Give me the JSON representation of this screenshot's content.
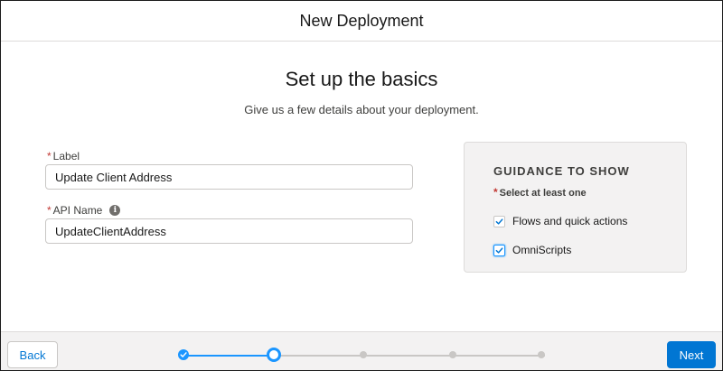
{
  "header": {
    "title": "New Deployment"
  },
  "main": {
    "heading": "Set up the basics",
    "subheading": "Give us a few details about your deployment."
  },
  "form": {
    "label_field": {
      "required_marker": "*",
      "label": "Label",
      "value": "Update Client Address"
    },
    "api_field": {
      "required_marker": "*",
      "label": "API Name",
      "value": "UpdateClientAddress",
      "info_icon": "info-icon"
    }
  },
  "guidance": {
    "title": "GUIDANCE TO SHOW",
    "required_marker": "*",
    "requirement": "Select at least one",
    "options": [
      {
        "label": "Flows and quick actions",
        "checked": true
      },
      {
        "label": "OmniScripts",
        "checked": true
      }
    ]
  },
  "footer": {
    "back_label": "Back",
    "next_label": "Next",
    "progress": {
      "steps": 5,
      "completed": 1,
      "current": 2
    }
  },
  "colors": {
    "brand": "#0176d3",
    "progress_active": "#1b96ff",
    "progress_inactive": "#c9c7c5",
    "required": "#c23934"
  }
}
